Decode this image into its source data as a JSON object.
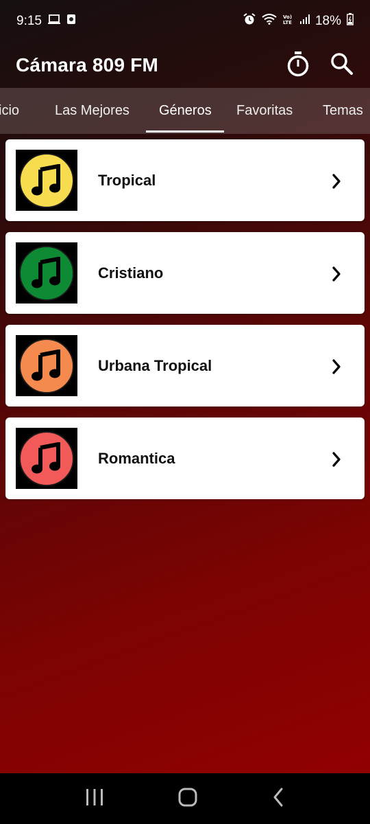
{
  "status": {
    "time": "9:15",
    "battery": "18%",
    "left_icons": [
      "laptop-icon",
      "screen-record-icon"
    ],
    "right_icons": [
      "alarm-icon",
      "wifi-icon",
      "volte-icon",
      "signal-icon",
      "battery-icon"
    ]
  },
  "app_bar": {
    "title": "Cámara 809 FM",
    "actions": [
      "timer-icon",
      "search-icon"
    ]
  },
  "tabs": {
    "items": [
      "icio",
      "Las Mejores",
      "Géneros",
      "Favoritas",
      "Temas"
    ],
    "active": "Géneros"
  },
  "genres": [
    {
      "label": "Tropical",
      "color": "#f7dc4f"
    },
    {
      "label": "Cristiano",
      "color": "#0e8a35"
    },
    {
      "label": "Urbana Tropical",
      "color": "#f58a4f"
    },
    {
      "label": "Romantica",
      "color": "#f25a5a"
    }
  ],
  "colors": {
    "background_top": "#161010",
    "background_bottom": "#960000",
    "tab_bar": "#6e5a5a",
    "card": "#ffffff"
  }
}
